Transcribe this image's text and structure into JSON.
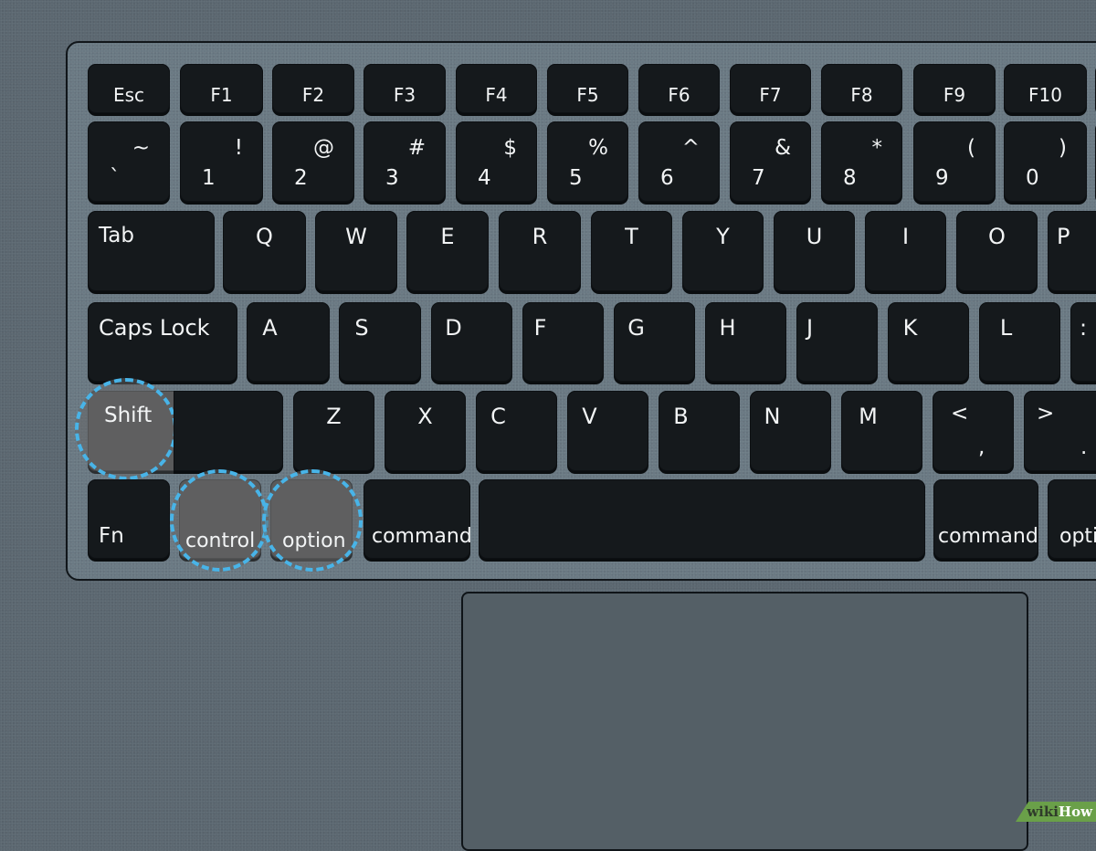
{
  "function_row": [
    "Esc",
    "F1",
    "F2",
    "F3",
    "F4",
    "F5",
    "F6",
    "F7",
    "F8",
    "F9",
    "F10"
  ],
  "number_row": [
    {
      "top": "~",
      "bottom": "`"
    },
    {
      "top": "!",
      "bottom": "1"
    },
    {
      "top": "@",
      "bottom": "2"
    },
    {
      "top": "#",
      "bottom": "3"
    },
    {
      "top": "$",
      "bottom": "4"
    },
    {
      "top": "%",
      "bottom": "5"
    },
    {
      "top": "^",
      "bottom": "6"
    },
    {
      "top": "&",
      "bottom": "7"
    },
    {
      "top": "*",
      "bottom": "8"
    },
    {
      "top": "(",
      "bottom": "9"
    },
    {
      "top": ")",
      "bottom": "0"
    }
  ],
  "qwerty_row": {
    "tab": "Tab",
    "keys": [
      "Q",
      "W",
      "E",
      "R",
      "T",
      "Y",
      "U",
      "I",
      "O",
      "P"
    ]
  },
  "home_row": {
    "caps": "Caps Lock",
    "keys": [
      "A",
      "S",
      "D",
      "F",
      "G",
      "H",
      "J",
      "K",
      "L"
    ],
    "partial": ":"
  },
  "shift_row": {
    "shift": "Shift",
    "keys": [
      "Z",
      "X",
      "C",
      "V",
      "B",
      "N",
      "M"
    ],
    "comma": {
      "top": "<",
      "bottom": ","
    },
    "period": {
      "top": ">",
      "bottom": "."
    }
  },
  "bottom_row": {
    "fn": "Fn",
    "control": "control",
    "option": "option",
    "command": "command",
    "space": "",
    "command_right": "command",
    "option_right": "opti"
  },
  "highlighted_keys": [
    "Shift",
    "control",
    "option"
  ],
  "highlight_color": "#48b4e8",
  "watermark": {
    "part1": "wiki",
    "part2": "How"
  }
}
